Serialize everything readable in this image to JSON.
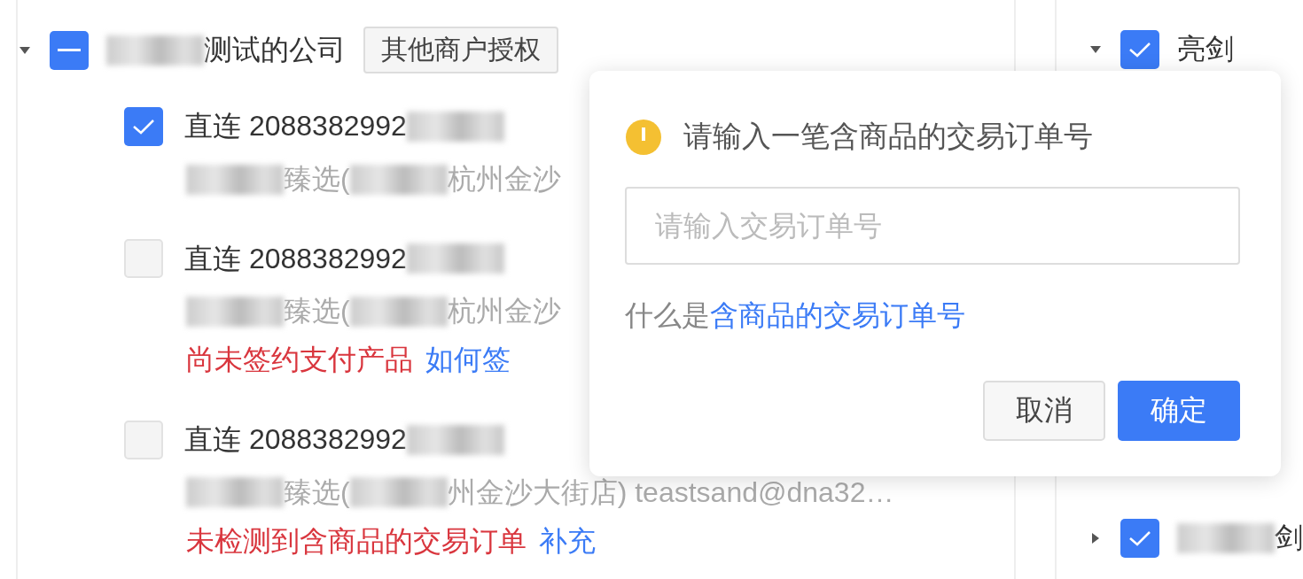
{
  "left_tree": {
    "expanded": true,
    "checked": false,
    "indeterminate": true,
    "label": [
      {
        "kind": "blur"
      },
      {
        "kind": "text",
        "text": "测试的公司"
      }
    ],
    "tag": "其他商户授权",
    "children": [
      {
        "checked": true,
        "title": [
          {
            "kind": "text",
            "text": "直连 2088382992"
          },
          {
            "kind": "blur"
          }
        ],
        "subtitle": [
          {
            "kind": "blur"
          },
          {
            "kind": "text",
            "text": "臻选("
          },
          {
            "kind": "blur"
          },
          {
            "kind": "text",
            "text": "杭州金沙"
          }
        ]
      },
      {
        "checked": false,
        "title": [
          {
            "kind": "text",
            "text": "直连 2088382992"
          },
          {
            "kind": "blur"
          }
        ],
        "subtitle": [
          {
            "kind": "blur"
          },
          {
            "kind": "text",
            "text": "臻选("
          },
          {
            "kind": "blur"
          },
          {
            "kind": "text",
            "text": "杭州金沙"
          }
        ],
        "notice": {
          "text": "尚未签约支付产品",
          "link": "如何签"
        }
      },
      {
        "checked": false,
        "title": [
          {
            "kind": "text",
            "text": "直连 2088382992"
          },
          {
            "kind": "blur"
          }
        ],
        "subtitle": [
          {
            "kind": "blur"
          },
          {
            "kind": "text",
            "text": "臻选("
          },
          {
            "kind": "blur"
          },
          {
            "kind": "text",
            "text": "州金沙大街店) teastsand@dna32…"
          }
        ],
        "notice": {
          "text": "未检测到含商品的交易订单",
          "link": "补充"
        }
      }
    ]
  },
  "right_tree": [
    {
      "expanded": true,
      "checked": true,
      "label": [
        {
          "kind": "text",
          "text": "亮剑"
        }
      ]
    },
    {
      "expanded": false,
      "checked": true,
      "label": [
        {
          "kind": "blur"
        },
        {
          "kind": "text",
          "text": "剑"
        }
      ]
    }
  ],
  "popover": {
    "title": "请输入一笔含商品的交易订单号",
    "input": {
      "placeholder": "请输入交易订单号"
    },
    "help": {
      "text": "什么是",
      "link": "含商品的交易订单号"
    },
    "buttons": [
      {
        "label": "取消",
        "primary": false
      },
      {
        "label": "确定",
        "primary": true
      }
    ]
  }
}
